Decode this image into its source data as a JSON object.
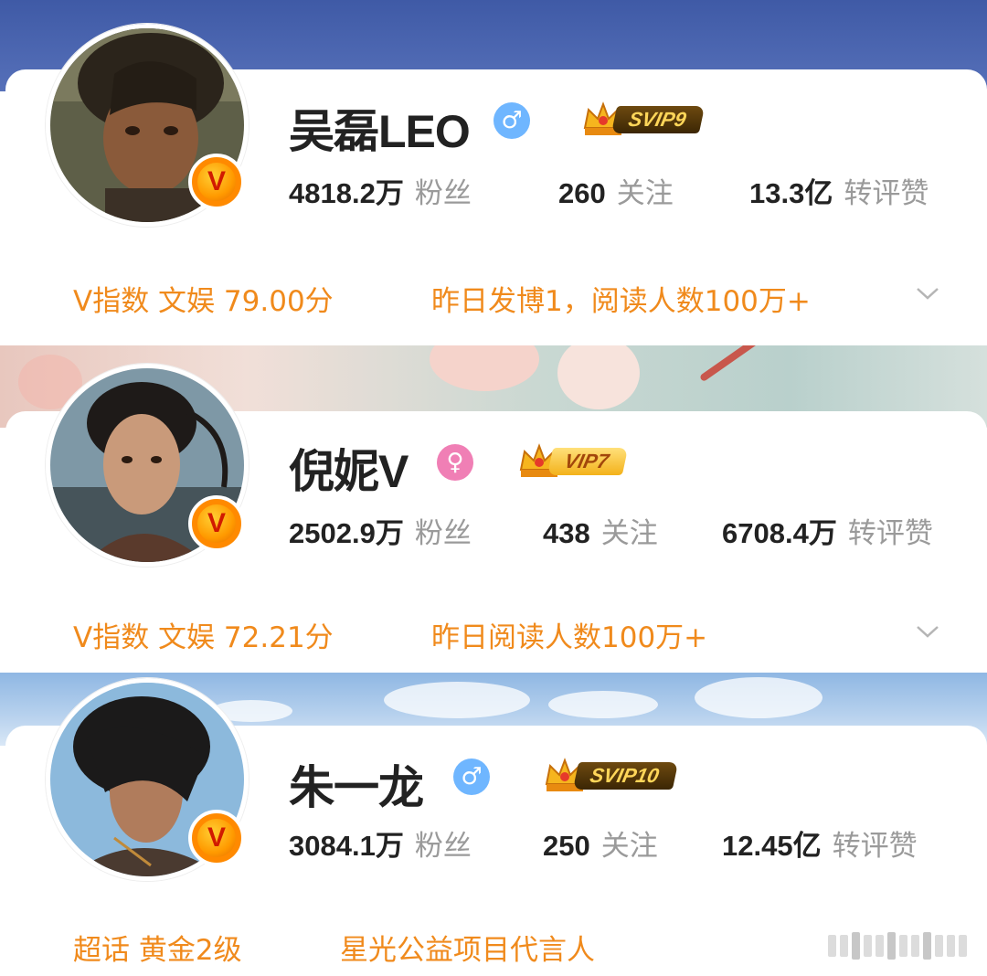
{
  "profiles": [
    {
      "name": "吴磊LEO",
      "gender_icon": "male-icon",
      "vip_label": "SVIP9",
      "verified_icon": "v-verified-icon",
      "stats": [
        {
          "value": "4818.2万",
          "label": "粉丝"
        },
        {
          "value": "260",
          "label": "关注"
        },
        {
          "value": "13.3亿",
          "label": "转评赞"
        }
      ],
      "info_left": "V指数 文娱 79.00分",
      "info_right": "昨日发博1，阅读人数100万+",
      "expand_icon": "chevron-down-icon"
    },
    {
      "name": "倪妮V",
      "gender_icon": "female-icon",
      "vip_label": "VIP7",
      "verified_icon": "v-verified-icon",
      "stats": [
        {
          "value": "2502.9万",
          "label": "粉丝"
        },
        {
          "value": "438",
          "label": "关注"
        },
        {
          "value": "6708.4万",
          "label": "转评赞"
        }
      ],
      "info_left": "V指数 文娱 72.21分",
      "info_right": "昨日阅读人数100万+",
      "expand_icon": "chevron-down-icon"
    },
    {
      "name": "朱一龙",
      "gender_icon": "male-icon",
      "vip_label": "SVIP10",
      "verified_icon": "v-verified-icon",
      "stats": [
        {
          "value": "3084.1万",
          "label": "粉丝"
        },
        {
          "value": "250",
          "label": "关注"
        },
        {
          "value": "12.45亿",
          "label": "转评赞"
        }
      ],
      "info_left": "超话 黄金2级",
      "info_right": "星光公益项目代言人"
    }
  ],
  "colors": {
    "accent_orange": "#f08a1c",
    "male_blue": "#6fb6ff",
    "female_pink": "#f07fb5",
    "vip_gold": "#ffd659"
  }
}
